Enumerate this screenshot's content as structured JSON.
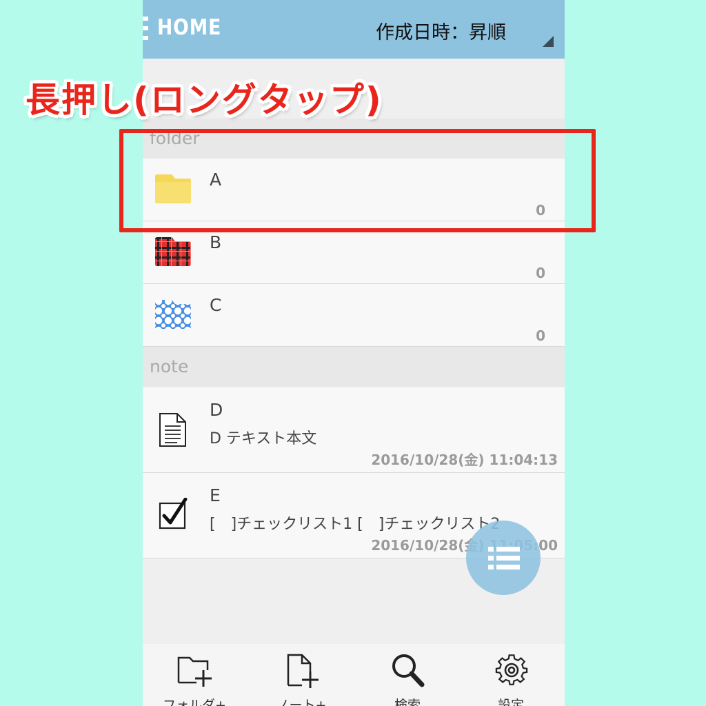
{
  "header": {
    "title": "HOME",
    "sort_label": "作成日時：昇順"
  },
  "sections": {
    "folder_label": "folder",
    "note_label": "note"
  },
  "folders": [
    {
      "name": "A",
      "count": "0",
      "icon": "folder-yellow-icon"
    },
    {
      "name": "B",
      "count": "0",
      "icon": "folder-red-plaid-icon"
    },
    {
      "name": "C",
      "count": "0",
      "icon": "folder-blue-polkadot-icon"
    }
  ],
  "notes": [
    {
      "title": "D",
      "preview": "D テキスト本文",
      "date": "2016/10/28(金) 11:04:13",
      "icon": "text-document-icon"
    },
    {
      "title": "E",
      "preview": "[　]チェックリスト1 [　]チェックリスト2",
      "date": "2016/10/28(金) 11:05:00",
      "icon": "checklist-icon"
    }
  ],
  "bottom_nav": [
    {
      "label": "フォルダ+",
      "icon": "folder-add-icon"
    },
    {
      "label": "ノート+",
      "icon": "note-add-icon"
    },
    {
      "label": "検索",
      "icon": "search-icon"
    },
    {
      "label": "設定",
      "icon": "gear-icon"
    }
  ],
  "annotation": {
    "label": "長押し(ロングタップ)",
    "color": "#e8261c"
  },
  "colors": {
    "appbar": "#8ec3e0",
    "background": "#b4fbec"
  }
}
